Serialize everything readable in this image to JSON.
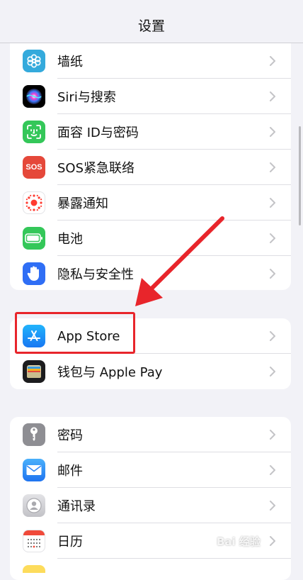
{
  "header": {
    "title": "设置"
  },
  "groups": [
    {
      "items": [
        {
          "label": "墙纸",
          "icon": "wallpaper-icon",
          "color": "#34aadc"
        },
        {
          "label": "Siri与搜索",
          "icon": "siri-icon",
          "color": "#000000"
        },
        {
          "label": "面容 ID与密码",
          "icon": "face-id-icon",
          "color": "#34c759"
        },
        {
          "label": "SOS紧急联络",
          "icon": "sos-icon",
          "color": "#e5483a"
        },
        {
          "label": "暴露通知",
          "icon": "exposure-notification-icon",
          "color": "#ffffff"
        },
        {
          "label": "电池",
          "icon": "battery-icon",
          "color": "#34c759"
        },
        {
          "label": "隐私与安全性",
          "icon": "privacy-hand-icon",
          "color": "#2f6ef5"
        }
      ]
    },
    {
      "items": [
        {
          "label": "App Store",
          "icon": "app-store-icon",
          "color": "#1b8cf8"
        },
        {
          "label": "钱包与 Apple Pay",
          "icon": "wallet-icon",
          "color": "#1c1c1e"
        }
      ]
    },
    {
      "items": [
        {
          "label": "密码",
          "icon": "key-icon",
          "color": "#8e8e93"
        },
        {
          "label": "邮件",
          "icon": "mail-icon",
          "color": "#2f86f6"
        },
        {
          "label": "通讯录",
          "icon": "contacts-icon",
          "color": "#c7c7cc"
        },
        {
          "label": "日历",
          "icon": "calendar-icon",
          "color": "#ffffff"
        }
      ]
    }
  ],
  "icons": {
    "sos_text": "SOS"
  },
  "annotation": {
    "highlight_color": "#e8252b"
  },
  "watermark": {
    "text": "Bai 经验"
  }
}
